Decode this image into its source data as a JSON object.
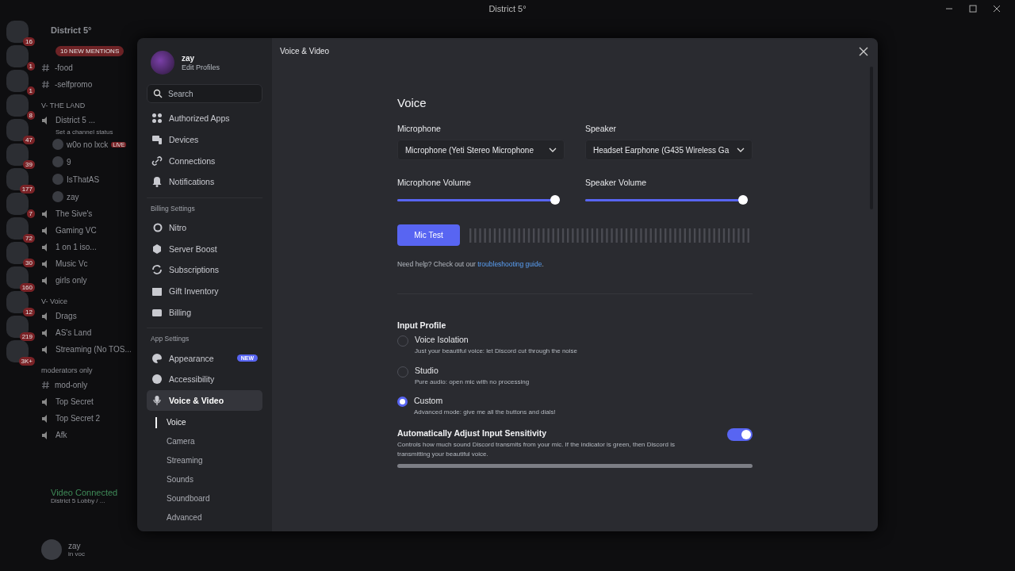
{
  "titlebar": {
    "title": "District 5°"
  },
  "server_rail": {
    "servers": [
      {
        "badge": "16"
      },
      {
        "badge": "1"
      },
      {
        "badge": "1"
      },
      {
        "badge": "8"
      },
      {
        "badge": "47"
      },
      {
        "badge": "39"
      },
      {
        "badge": "177"
      },
      {
        "badge": "7"
      },
      {
        "badge": "72"
      },
      {
        "badge": "30"
      },
      {
        "badge": "160"
      },
      {
        "badge": "12"
      },
      {
        "badge": "219"
      },
      {
        "badge": "3K+"
      }
    ]
  },
  "channels": {
    "server_name": "District 5°",
    "items": [
      {
        "kind": "mention",
        "name": "10 NEW MENTIONS"
      },
      {
        "kind": "text",
        "name": "-food"
      },
      {
        "kind": "text",
        "name": "-selfpromo"
      },
      {
        "kind": "category",
        "name": "V- THE LAND"
      },
      {
        "kind": "voice",
        "name": "District 5 ...",
        "status": "Set a channel status"
      },
      {
        "kind": "user",
        "name": "w0o no lxck",
        "live": "LIVE"
      },
      {
        "kind": "user",
        "name": "9"
      },
      {
        "kind": "user",
        "name": "IsThatAS"
      },
      {
        "kind": "user",
        "name": "zay"
      },
      {
        "kind": "voice",
        "name": "The Sive's"
      },
      {
        "kind": "voice",
        "name": "Gaming VC"
      },
      {
        "kind": "voice",
        "name": "1 on 1 iso..."
      },
      {
        "kind": "voice",
        "name": "Music Vc"
      },
      {
        "kind": "voice",
        "name": "girls only"
      },
      {
        "kind": "category",
        "name": "V- Voice"
      },
      {
        "kind": "voice",
        "name": "Drags"
      },
      {
        "kind": "voice",
        "name": "AS's Land"
      },
      {
        "kind": "voice",
        "name": "Streaming (No TOS..."
      },
      {
        "kind": "category",
        "name": "moderators only"
      },
      {
        "kind": "text",
        "name": "mod-only"
      },
      {
        "kind": "voice",
        "name": "Top Secret"
      },
      {
        "kind": "voice",
        "name": "Top Secret 2"
      },
      {
        "kind": "voice",
        "name": "Afk"
      }
    ]
  },
  "voice_panel": {
    "status": "Video Connected",
    "channel": "District 5 Lobby / ..."
  },
  "user_panel": {
    "name": "zay",
    "status": "in voc"
  },
  "modal": {
    "title": "Voice & Video",
    "profile": {
      "name": "zay",
      "link": "Edit Profiles"
    },
    "search": {
      "placeholder": "Search"
    },
    "groups": [
      {
        "items": [
          {
            "label": "Authorized Apps",
            "selected": false
          },
          {
            "label": "Devices",
            "selected": false
          },
          {
            "label": "Connections",
            "selected": false
          },
          {
            "label": "Notifications",
            "selected": false
          }
        ]
      },
      {
        "header": "Billing Settings",
        "items": [
          {
            "label": "Nitro",
            "selected": false
          },
          {
            "label": "Server Boost",
            "selected": false
          },
          {
            "label": "Subscriptions",
            "selected": false
          },
          {
            "label": "Gift Inventory",
            "selected": false
          },
          {
            "label": "Billing",
            "selected": false
          }
        ]
      },
      {
        "header": "App Settings",
        "items": [
          {
            "label": "Appearance",
            "selected": false,
            "badge": "NEW"
          },
          {
            "label": "Accessibility",
            "selected": false
          },
          {
            "label": "Voice & Video",
            "selected": true,
            "children": [
              {
                "label": "Voice",
                "selected": true
              },
              {
                "label": "Camera",
                "selected": false
              },
              {
                "label": "Streaming",
                "selected": false
              },
              {
                "label": "Sounds",
                "selected": false
              },
              {
                "label": "Soundboard",
                "selected": false
              },
              {
                "label": "Advanced",
                "selected": false
              }
            ]
          }
        ]
      }
    ],
    "voice": {
      "heading": "Voice",
      "devices": [
        {
          "label": "Microphone",
          "value": "Microphone (Yeti Stereo Microphone"
        },
        {
          "label": "Speaker",
          "value": "Headset Earphone (G435 Wireless Ga"
        }
      ],
      "volumes": [
        {
          "label": "Microphone Volume",
          "level": 1.0
        },
        {
          "label": "Speaker Volume",
          "level": 1.0
        }
      ],
      "mic_test": "Mic Test",
      "help": {
        "text": "Need help? Check out our ",
        "link": "troubleshooting guide",
        "end": "."
      },
      "input_profile": {
        "heading": "Input Profile",
        "options": [
          {
            "label": "Voice Isolation",
            "description": "Just your beautiful voice: let Discord cut through the noise",
            "selected": false
          },
          {
            "label": "Studio",
            "description": "Pure audio: open mic with no processing",
            "selected": false
          },
          {
            "label": "Custom",
            "description": "Advanced mode: give me all the buttons and dials!",
            "selected": true
          }
        ]
      },
      "auto_sensitivity": {
        "label": "Automatically Adjust Input Sensitivity",
        "description": "Controls how much sound Discord transmits from your mic. If the indicator is green, then Discord is transmitting your beautiful voice.",
        "on": true
      }
    }
  }
}
